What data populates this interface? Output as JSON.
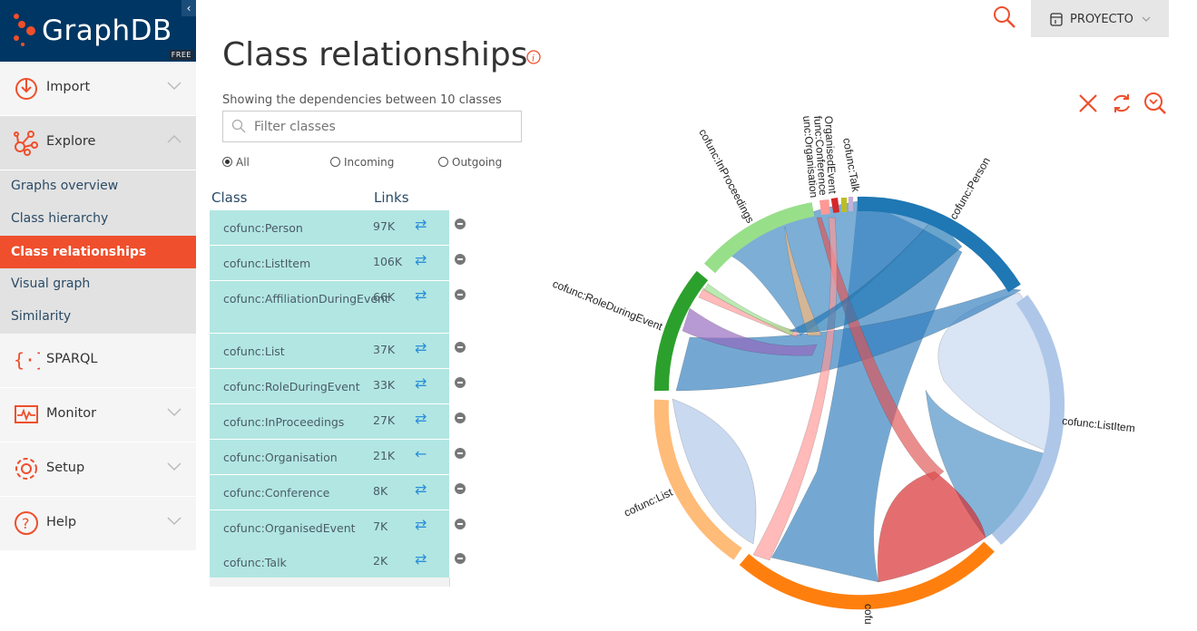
{
  "app": {
    "brand": "GraphDB",
    "edition": "FREE"
  },
  "nav": {
    "import": "Import",
    "explore": "Explore",
    "sparql": "SPARQL",
    "monitor": "Monitor",
    "setup": "Setup",
    "help": "Help",
    "explore_items": [
      "Graphs overview",
      "Class hierarchy",
      "Class relationships",
      "Visual graph",
      "Similarity"
    ]
  },
  "header": {
    "repository": "PROYECTO"
  },
  "main": {
    "title": "Class relationships",
    "showing": "Showing the dependencies between 10 classes",
    "filter_placeholder": "Filter classes",
    "radios": {
      "all": "All",
      "incoming": "Incoming",
      "outgoing": "Outgoing"
    },
    "col_class": "Class",
    "col_links": "Links"
  },
  "classes": [
    {
      "name": "cofunc:Person",
      "links": "97K",
      "dir": "⇄"
    },
    {
      "name": "cofunc:ListItem",
      "links": "106K",
      "dir": "⇄"
    },
    {
      "name": "cofunc:AffiliationDuringEvent",
      "links": "66K",
      "dir": "⇄"
    },
    {
      "name": "cofunc:List",
      "links": "37K",
      "dir": "⇄"
    },
    {
      "name": "cofunc:RoleDuringEvent",
      "links": "33K",
      "dir": "⇄"
    },
    {
      "name": "cofunc:InProceedings",
      "links": "27K",
      "dir": "⇄"
    },
    {
      "name": "cofunc:Organisation",
      "links": "21K",
      "dir": "←"
    },
    {
      "name": "cofunc:Conference",
      "links": "8K",
      "dir": "⇄"
    },
    {
      "name": "cofunc:OrganisedEvent",
      "links": "7K",
      "dir": "⇄"
    },
    {
      "name": "cofunc:Talk",
      "links": "2K",
      "dir": "⇄"
    }
  ],
  "chord_labels": {
    "person": "cofunc:Person",
    "listitem": "cofunc:ListItem",
    "list": "cofunc:List",
    "role": "cofunc:RoleDuringEvent",
    "inproc": "cofunc:InProceedings",
    "org": "unc:Organisation",
    "conf": "func:Conference",
    "orgevent": "OrganisedEvent",
    "talk": "cofunc:Talk",
    "affil": "cofu"
  },
  "colors": {
    "accent": "#ef4f2c",
    "brand_bg": "#003663",
    "row_bg": "#b2e6e2",
    "person": "#1f77b4",
    "listitem": "#aec7e8",
    "affiliation": "#ff7f0e",
    "list": "#ffbb78",
    "role": "#2ca02c",
    "inproceedings": "#98df8a"
  }
}
